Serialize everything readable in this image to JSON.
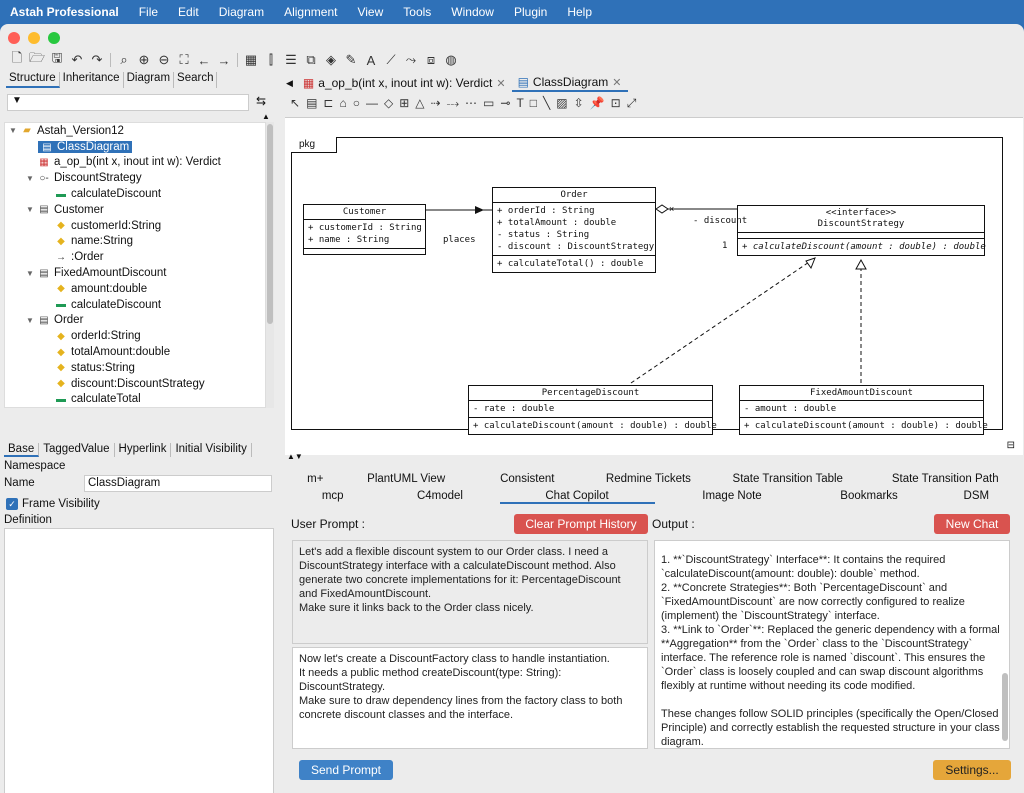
{
  "menubar": {
    "app": "Astah Professional",
    "items": [
      "File",
      "Edit",
      "Diagram",
      "Alignment",
      "View",
      "Tools",
      "Window",
      "Plugin",
      "Help"
    ]
  },
  "colors": {
    "accent": "#2f71b8",
    "danger": "#d9534f",
    "settings": "#e5a63a"
  },
  "left_tabs": [
    "Structure",
    "Inheritance",
    "Diagram",
    "Search"
  ],
  "tree": [
    {
      "label": "Astah_Version12",
      "indent": 0,
      "icon": "folder-icon",
      "expander": "▼"
    },
    {
      "label": "ClassDiagram",
      "indent": 1,
      "icon": "class-diagram-icon",
      "selected": true
    },
    {
      "label": "a_op_b(int x, inout int w): Verdict",
      "indent": 1,
      "icon": "ctd-diagram-icon"
    },
    {
      "label": "DiscountStrategy",
      "indent": 1,
      "icon": "interface-icon",
      "expander": "▼"
    },
    {
      "label": "calculateDiscount",
      "indent": 2,
      "icon": "operation-icon"
    },
    {
      "label": "Customer",
      "indent": 1,
      "icon": "class-icon",
      "expander": "▼"
    },
    {
      "label": "customerId:String",
      "indent": 2,
      "icon": "attribute-icon"
    },
    {
      "label": "name:String",
      "indent": 2,
      "icon": "attribute-icon"
    },
    {
      "label": ":Order",
      "indent": 2,
      "icon": "association-end-icon"
    },
    {
      "label": "FixedAmountDiscount",
      "indent": 1,
      "icon": "class-icon",
      "expander": "▼"
    },
    {
      "label": "amount:double",
      "indent": 2,
      "icon": "attribute-icon"
    },
    {
      "label": "calculateDiscount",
      "indent": 2,
      "icon": "operation-icon"
    },
    {
      "label": "Order",
      "indent": 1,
      "icon": "class-icon",
      "expander": "▼"
    },
    {
      "label": "orderId:String",
      "indent": 2,
      "icon": "attribute-icon"
    },
    {
      "label": "totalAmount:double",
      "indent": 2,
      "icon": "attribute-icon"
    },
    {
      "label": "status:String",
      "indent": 2,
      "icon": "attribute-icon"
    },
    {
      "label": "discount:DiscountStrategy",
      "indent": 2,
      "icon": "attribute-icon"
    },
    {
      "label": "calculateTotal",
      "indent": 2,
      "icon": "operation-icon"
    }
  ],
  "prop_tabs": [
    "Base",
    "TaggedValue",
    "Hyperlink",
    "Initial Visibility"
  ],
  "props": {
    "section": "Namespace",
    "name_label": "Name",
    "name_value": "ClassDiagram",
    "frame_visibility": "Frame Visibility",
    "definition": "Definition"
  },
  "editor_tabs": [
    {
      "label": "a_op_b(int x, inout int w): Verdict",
      "active": false
    },
    {
      "label": "ClassDiagram",
      "active": true
    }
  ],
  "diagram": {
    "package": "pkg",
    "classes": {
      "customer": {
        "name": "Customer",
        "attrs": [
          "+ customerId : String",
          "+ name : String"
        ],
        "ops": []
      },
      "order": {
        "name": "Order",
        "attrs": [
          "+ orderId : String",
          "+ totalAmount : double",
          "- status : String",
          "- discount : DiscountStrategy"
        ],
        "ops": [
          "+ calculateTotal() : double"
        ]
      },
      "strategy": {
        "stereotype": "<<interface>>",
        "name": "DiscountStrategy",
        "attrs": [],
        "ops": [
          "+ calculateDiscount(amount : double) : double"
        ]
      },
      "percentage": {
        "name": "PercentageDiscount",
        "attrs": [
          "- rate : double"
        ],
        "ops": [
          "+ calculateDiscount(amount : double) : double"
        ]
      },
      "fixed": {
        "name": "FixedAmountDiscount",
        "attrs": [
          "- amount : double"
        ],
        "ops": [
          "+ calculateDiscount(amount : double) : double"
        ]
      }
    },
    "labels": {
      "places": "places",
      "discount_role": "- discount",
      "multiplicity": "1"
    }
  },
  "bottom_tabs_row1": [
    "m+",
    "PlantUML View",
    "Consistent",
    "Redmine Tickets",
    "State Transition Table",
    "State Transition Path"
  ],
  "bottom_tabs_row2": [
    "mcp",
    "C4model",
    "Chat Copilot",
    "Image Note",
    "Bookmarks",
    "DSM"
  ],
  "copilot": {
    "user_prompt_label": "User Prompt :",
    "clear_button": "Clear Prompt History",
    "output_label": "Output :",
    "new_chat_button": "New Chat",
    "history": [
      "Let's add a flexible discount system to our Order class. I need a DiscountStrategy interface with a calculateDiscount method. Also generate two concrete implementations for it: PercentageDiscount and FixedAmountDiscount.",
      "Make sure it links back to the Order class nicely."
    ],
    "prompt": [
      "Now let's create a DiscountFactory class to handle instantiation.",
      "It needs a public method createDiscount(type: String): DiscountStrategy.",
      "Make sure to draw dependency lines from the factory class to both concrete discount classes and the interface."
    ],
    "output": [
      "1. **`DiscountStrategy` Interface**: It contains the required `calculateDiscount(amount: double): double` method.",
      "2. **Concrete Strategies**: Both `PercentageDiscount` and `FixedAmountDiscount` are now correctly configured to realize (implement) the `DiscountStrategy` interface.",
      "3. **Link to `Order`**: Replaced the generic dependency with a formal **Aggregation** from the `Order` class to the `DiscountStrategy` interface. The reference role is named `discount`. This ensures the `Order` class is loosely coupled and can swap discount algorithms flexibly at runtime without needing its code modified.",
      "",
      "These changes follow SOLID principles (specifically the Open/Closed Principle) and correctly establish the requested structure in your class diagram."
    ],
    "send_button": "Send Prompt",
    "settings_button": "Settings..."
  }
}
